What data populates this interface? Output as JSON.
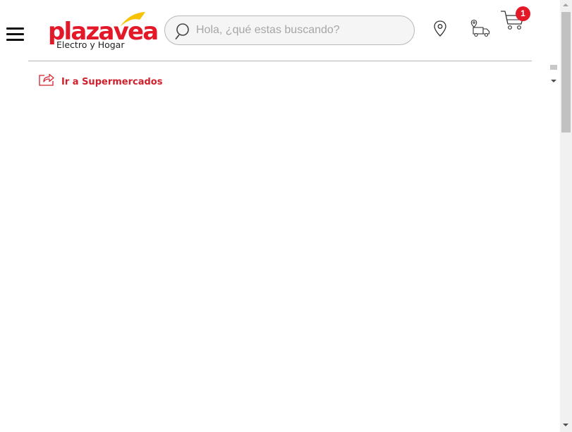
{
  "header": {
    "logo": {
      "brand_part1": "plaza",
      "brand_part2": "vea",
      "subtitle": "Electro y Hogar",
      "brand_red": "#e3192a",
      "brand_yellow": "#f7c300"
    },
    "menu_icon": "hamburger-menu-icon",
    "search": {
      "placeholder": "Hola, ¿qué estas buscando?",
      "value": "",
      "icon": "search-icon"
    },
    "location_icon": "location-pin-icon",
    "delivery_icon": "delivery-truck-icon",
    "cart": {
      "icon": "shopping-cart-icon",
      "count": "1",
      "badge_color": "#e3192a"
    }
  },
  "links": {
    "supermercados": {
      "label": "Ir a Supermercados",
      "icon": "share-arrow-icon",
      "color": "#d0202b"
    }
  }
}
